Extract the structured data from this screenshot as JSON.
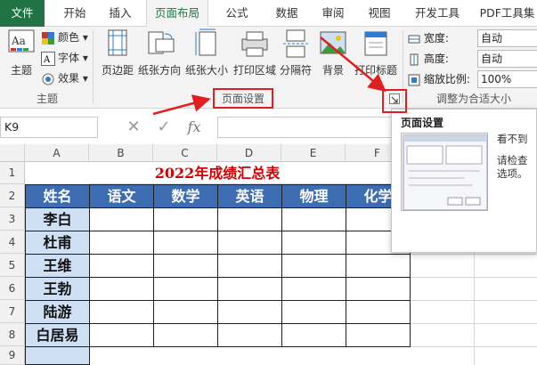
{
  "tabs": [
    {
      "label": "文件"
    },
    {
      "label": "开始"
    },
    {
      "label": "插入"
    },
    {
      "label": "页面布局"
    },
    {
      "label": "公式"
    },
    {
      "label": "数据"
    },
    {
      "label": "审阅"
    },
    {
      "label": "视图"
    },
    {
      "label": "开发工具"
    },
    {
      "label": "PDF工具集"
    }
  ],
  "ribbon": {
    "theme": {
      "main": "主题",
      "colors": "颜色",
      "fonts": "字体",
      "effects": "效果",
      "group_label": "主题"
    },
    "page_setup": {
      "margins": "页边距",
      "orientation": "纸张方向",
      "size": "纸张大小",
      "print_area": "打印区域",
      "breaks": "分隔符",
      "background": "背景",
      "print_titles": "打印标题",
      "group_label": "页面设置"
    },
    "scale": {
      "width_label": "宽度:",
      "width_value": "自动",
      "height_label": "高度:",
      "height_value": "自动",
      "scale_label": "缩放比例:",
      "scale_value": "100%",
      "group_label": "调整为合适大小"
    }
  },
  "formula_bar": {
    "name_box": "K9",
    "cancel": "✕",
    "enter": "✓",
    "fx": "fx"
  },
  "columns": [
    "A",
    "B",
    "C",
    "D",
    "E",
    "F"
  ],
  "rows": [
    "1",
    "2",
    "3",
    "4",
    "5",
    "6",
    "7",
    "8",
    "9"
  ],
  "sheet": {
    "title": "2022年成绩汇总表",
    "headers": [
      "姓名",
      "语文",
      "数学",
      "英语",
      "物理",
      "化学"
    ],
    "names": [
      "李白",
      "杜甫",
      "王维",
      "王勃",
      "陆游",
      "白居易"
    ]
  },
  "tooltip": {
    "title": "页面设置",
    "line1": "看不到",
    "line2": "请检查",
    "line3": "选项。"
  },
  "colors": {
    "accent": "#217346",
    "header_fill": "#3d6cb3",
    "name_fill": "#cfe0f4",
    "annotation": "#e02020",
    "title": "#d20000"
  }
}
